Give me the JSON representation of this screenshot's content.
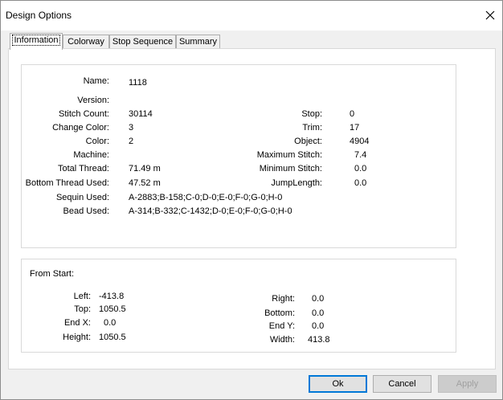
{
  "window": {
    "title": "Design Options"
  },
  "tabs": [
    "Information",
    "Colorway",
    "Stop Sequence",
    "Summary"
  ],
  "info": {
    "name_label": "Name:",
    "name": "1118",
    "version_label": "Version:",
    "version": "",
    "stitch_count_label": "Stitch Count:",
    "stitch_count": "30114",
    "change_color_label": "Change Color:",
    "change_color": "3",
    "color_label": "Color:",
    "color": "2",
    "machine_label": "Machine:",
    "machine": "",
    "total_thread_label": "Total Thread:",
    "total_thread": "71.49 m",
    "bottom_thread_label": "Bottom Thread Used:",
    "bottom_thread": "47.52 m",
    "sequin_label": "Sequin Used:",
    "sequin": "A-2883;B-158;C-0;D-0;E-0;F-0;G-0;H-0",
    "bead_label": "Bead Used:",
    "bead": "A-314;B-332;C-1432;D-0;E-0;F-0;G-0;H-0",
    "stop_label": "Stop:",
    "stop": "0",
    "trim_label": "Trim:",
    "trim": "17",
    "object_label": "Object:",
    "object": "4904",
    "max_stitch_label": "Maximum Stitch:",
    "max_stitch": "7.4",
    "min_stitch_label": "Minimum Stitch:",
    "min_stitch": "0.0",
    "jump_label": "JumpLength:",
    "jump": "0.0"
  },
  "from_start": {
    "heading": "From Start:",
    "left_label": "Left:",
    "left": "-413.8",
    "top_label": "Top:",
    "top": "1050.5",
    "endx_label": "End X:",
    "endx": "0.0",
    "height_label": "Height:",
    "height": "1050.5",
    "right_label": "Right:",
    "right": "0.0",
    "bottom_label": "Bottom:",
    "bottom": "0.0",
    "endy_label": "End Y:",
    "endy": "0.0",
    "width_label": "Width:",
    "width": "413.8"
  },
  "buttons": {
    "ok": "Ok",
    "cancel": "Cancel",
    "apply": "Apply"
  }
}
